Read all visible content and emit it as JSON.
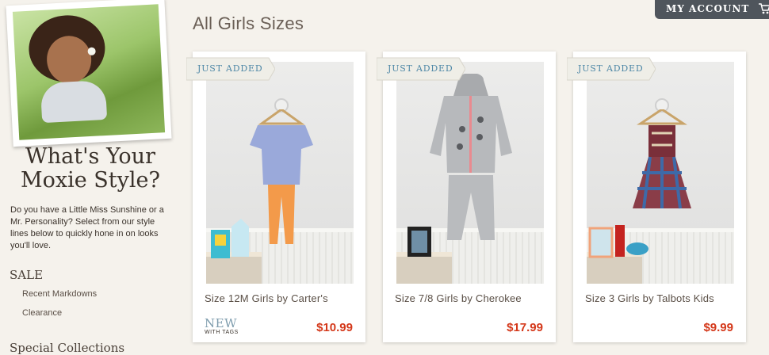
{
  "sidebar": {
    "headline": "What's Your Moxie Style?",
    "intro": "Do you have a Little Miss Sunshine or a Mr. Personality? Select from our style lines below to quickly hone in on looks you'll love.",
    "sections": [
      {
        "title": "SALE",
        "links": [
          "Recent Markdowns",
          "Clearance"
        ]
      },
      {
        "title": "Special Collections",
        "links": []
      }
    ]
  },
  "header": {
    "title": "All Girls Sizes",
    "account_label": "MY ACCOUNT"
  },
  "products": [
    {
      "badge": "JUST ADDED",
      "name": "Size 12M Girls by Carter's",
      "price": "$10.99",
      "condition": "NEW",
      "condition_sub": "WITH TAGS"
    },
    {
      "badge": "JUST ADDED",
      "name": "Size 7/8 Girls by Cherokee",
      "price": "$17.99"
    },
    {
      "badge": "JUST ADDED",
      "name": "Size 3 Girls by Talbots Kids",
      "price": "$9.99"
    }
  ],
  "colors": {
    "price": "#d4381a",
    "badge_text": "#4f88a7",
    "account_bg": "#4f555c"
  }
}
